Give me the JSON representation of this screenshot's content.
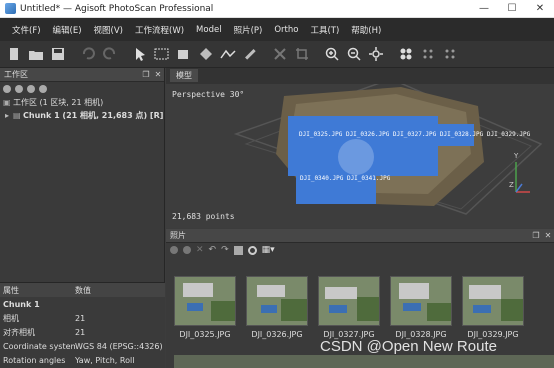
{
  "window": {
    "title": "Untitled* — Agisoft PhotoScan Professional",
    "minimize": "—",
    "maximize": "☐",
    "close": "✕"
  },
  "menu": [
    "文件(F)",
    "编辑(E)",
    "视图(V)",
    "工作流程(W)",
    "Model",
    "照片(P)",
    "Ortho",
    "工具(T)",
    "帮助(H)"
  ],
  "toolbar": [
    "new-icon",
    "open-icon",
    "save-icon",
    "undo-icon",
    "redo-icon",
    "navigation-icon",
    "rectangle-select-icon",
    "resize-region-icon",
    "rotate-region-icon",
    "ruler-icon",
    "delete-icon",
    "crop-icon",
    "zoom-in-icon",
    "zoom-out-icon",
    "move-object-icon",
    "show-cameras-icon",
    "show-aligned-icon"
  ],
  "workspace": {
    "header": "工作区",
    "root": "工作区 (1 区块, 21 相机)",
    "chunk": "Chunk 1 (21 相机, 21,683 点) [R]"
  },
  "properties": {
    "col_name": "属性",
    "col_value": "数值",
    "section": "Chunk 1",
    "rows": [
      {
        "k": "相机",
        "v": "21"
      },
      {
        "k": "对齐相机",
        "v": "21"
      },
      {
        "k": "Coordinate system",
        "v": "WGS 84 (EPSG::4326)"
      },
      {
        "k": "Rotation angles",
        "v": "Yaw, Pitch, Roll"
      }
    ]
  },
  "model": {
    "tab": "模型",
    "perspective": "Perspective 30°",
    "points": "21,683 points",
    "cam_label_top": "DJI_0325.JPG DJI_0326.JPG DJI_0327.JPG DJI_0328.JPG DJI_0329.JPG",
    "cam_label_bottom": "DJI_0340.JPG DJI_0341.JPG",
    "axis_y": "Y",
    "axis_z": "Z"
  },
  "photos": {
    "header": "照片",
    "items": [
      "DJI_0325.JPG",
      "DJI_0326.JPG",
      "DJI_0327.JPG",
      "DJI_0328.JPG",
      "DJI_0329.JPG"
    ]
  },
  "watermark": "CSDN @Open New Route"
}
